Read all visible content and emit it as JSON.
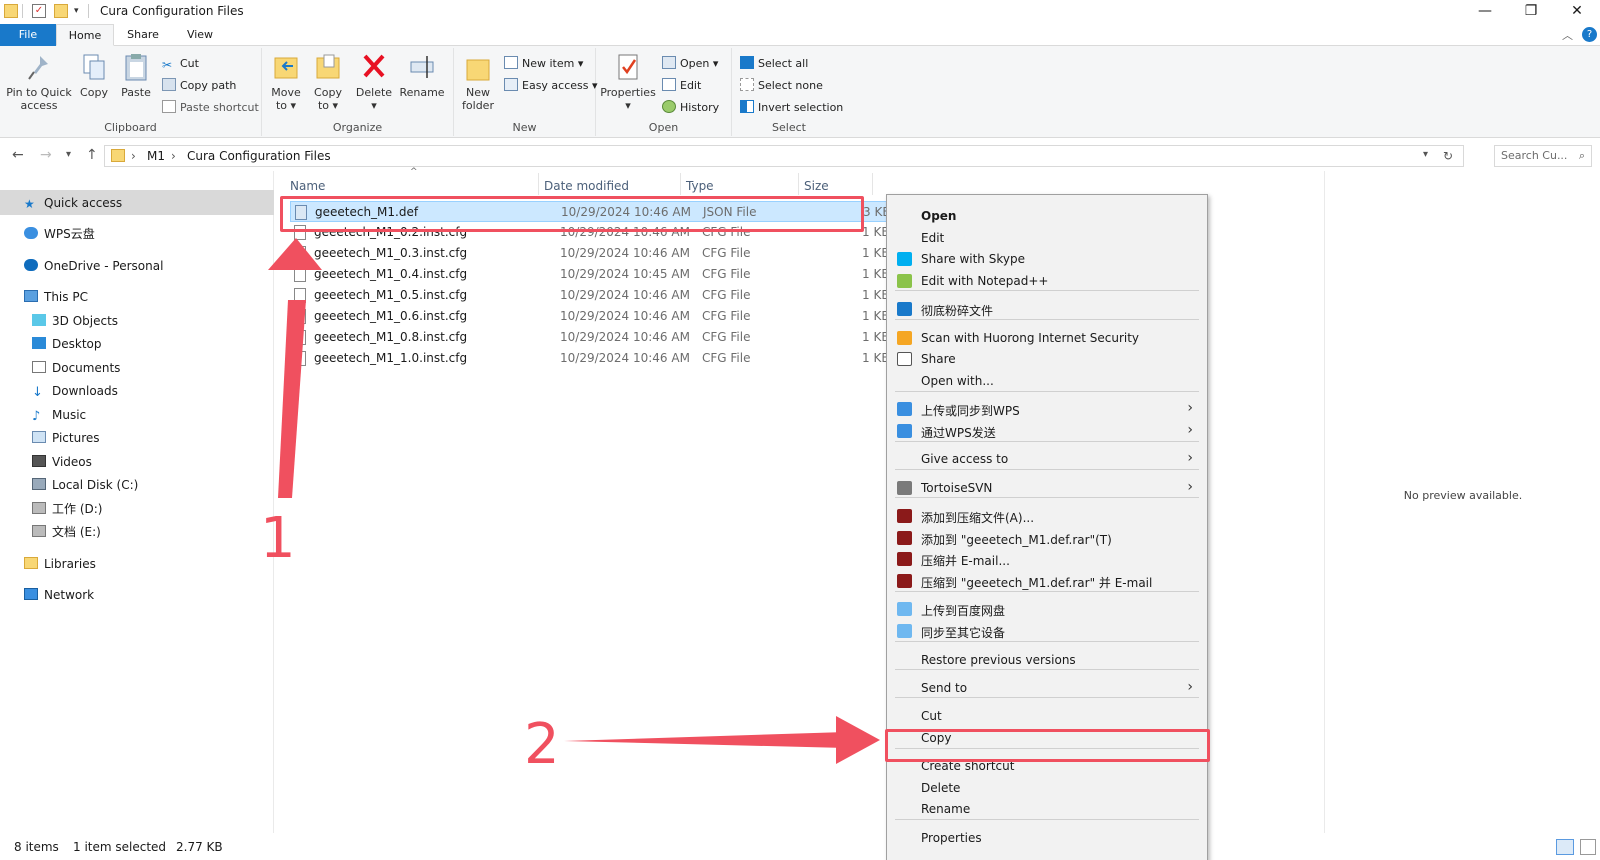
{
  "window": {
    "title": "Cura Configuration Files"
  },
  "tabs": {
    "file": "File",
    "home": "Home",
    "share": "Share",
    "view": "View"
  },
  "ribbon": {
    "clipboard": {
      "label": "Clipboard",
      "pin": "Pin to Quick\naccess",
      "copy": "Copy",
      "paste": "Paste",
      "cut": "Cut",
      "copy_path": "Copy path",
      "paste_shortcut": "Paste shortcut"
    },
    "organize": {
      "label": "Organize",
      "move_to": "Move\nto ▾",
      "copy_to": "Copy\nto ▾",
      "delete": "Delete\n▾",
      "rename": "Rename"
    },
    "new": {
      "label": "New",
      "new_folder": "New\nfolder",
      "new_item": "New item ▾",
      "easy_access": "Easy access ▾"
    },
    "open": {
      "label": "Open",
      "properties": "Properties\n▾",
      "open": "Open ▾",
      "edit": "Edit",
      "history": "History"
    },
    "select": {
      "label": "Select",
      "select_all": "Select all",
      "select_none": "Select none",
      "invert": "Invert selection"
    }
  },
  "address": {
    "crumbs": [
      "M1",
      "Cura Configuration Files"
    ],
    "search_placeholder": "Search Cu..."
  },
  "nav": {
    "items": [
      "Quick access",
      "WPS云盘",
      "OneDrive - Personal",
      "This PC",
      "3D Objects",
      "Desktop",
      "Documents",
      "Downloads",
      "Music",
      "Pictures",
      "Videos",
      "Local Disk (C:)",
      "工作 (D:)",
      "文档 (E:)",
      "Libraries",
      "Network"
    ]
  },
  "columns": {
    "name": "Name",
    "date": "Date modified",
    "type": "Type",
    "size": "Size"
  },
  "files": [
    {
      "name": "geeetech_M1.def",
      "date": "10/29/2024 10:46 AM",
      "type": "JSON File",
      "size": "3 KB"
    },
    {
      "name": "geeetech_M1_0.2.inst.cfg",
      "date": "10/29/2024 10:46 AM",
      "type": "CFG File",
      "size": "1 KB"
    },
    {
      "name": "geeetech_M1_0.3.inst.cfg",
      "date": "10/29/2024 10:46 AM",
      "type": "CFG File",
      "size": "1 KB"
    },
    {
      "name": "geeetech_M1_0.4.inst.cfg",
      "date": "10/29/2024 10:45 AM",
      "type": "CFG File",
      "size": "1 KB"
    },
    {
      "name": "geeetech_M1_0.5.inst.cfg",
      "date": "10/29/2024 10:46 AM",
      "type": "CFG File",
      "size": "1 KB"
    },
    {
      "name": "geeetech_M1_0.6.inst.cfg",
      "date": "10/29/2024 10:46 AM",
      "type": "CFG File",
      "size": "1 KB"
    },
    {
      "name": "geeetech_M1_0.8.inst.cfg",
      "date": "10/29/2024 10:46 AM",
      "type": "CFG File",
      "size": "1 KB"
    },
    {
      "name": "geeetech_M1_1.0.inst.cfg",
      "date": "10/29/2024 10:46 AM",
      "type": "CFG File",
      "size": "1 KB"
    }
  ],
  "menu": {
    "items": [
      "Open",
      "Edit",
      "Share with Skype",
      "Edit with Notepad++",
      "彻底粉碎文件",
      "Scan with Huorong Internet Security",
      "Share",
      "Open with...",
      "上传或同步到WPS",
      "通过WPS发送",
      "Give access to",
      "TortoiseSVN",
      "添加到压缩文件(A)...",
      "添加到 \"geeetech_M1.def.rar\"(T)",
      "压缩并 E-mail...",
      "压缩到 \"geeetech_M1.def.rar\" 并 E-mail",
      "上传到百度网盘",
      "同步至其它设备",
      "Restore previous versions",
      "Send to",
      "Cut",
      "Copy",
      "Create shortcut",
      "Delete",
      "Rename",
      "Properties"
    ]
  },
  "preview": {
    "text": "No preview available."
  },
  "status": {
    "count": "8 items",
    "selected": "1 item selected",
    "size": "2.77 KB"
  },
  "annotations": {
    "one": "1",
    "two": "2"
  },
  "colors": {
    "accent": "#1979ca",
    "selection": "#cce8ff",
    "annotation": "#f0505f"
  }
}
